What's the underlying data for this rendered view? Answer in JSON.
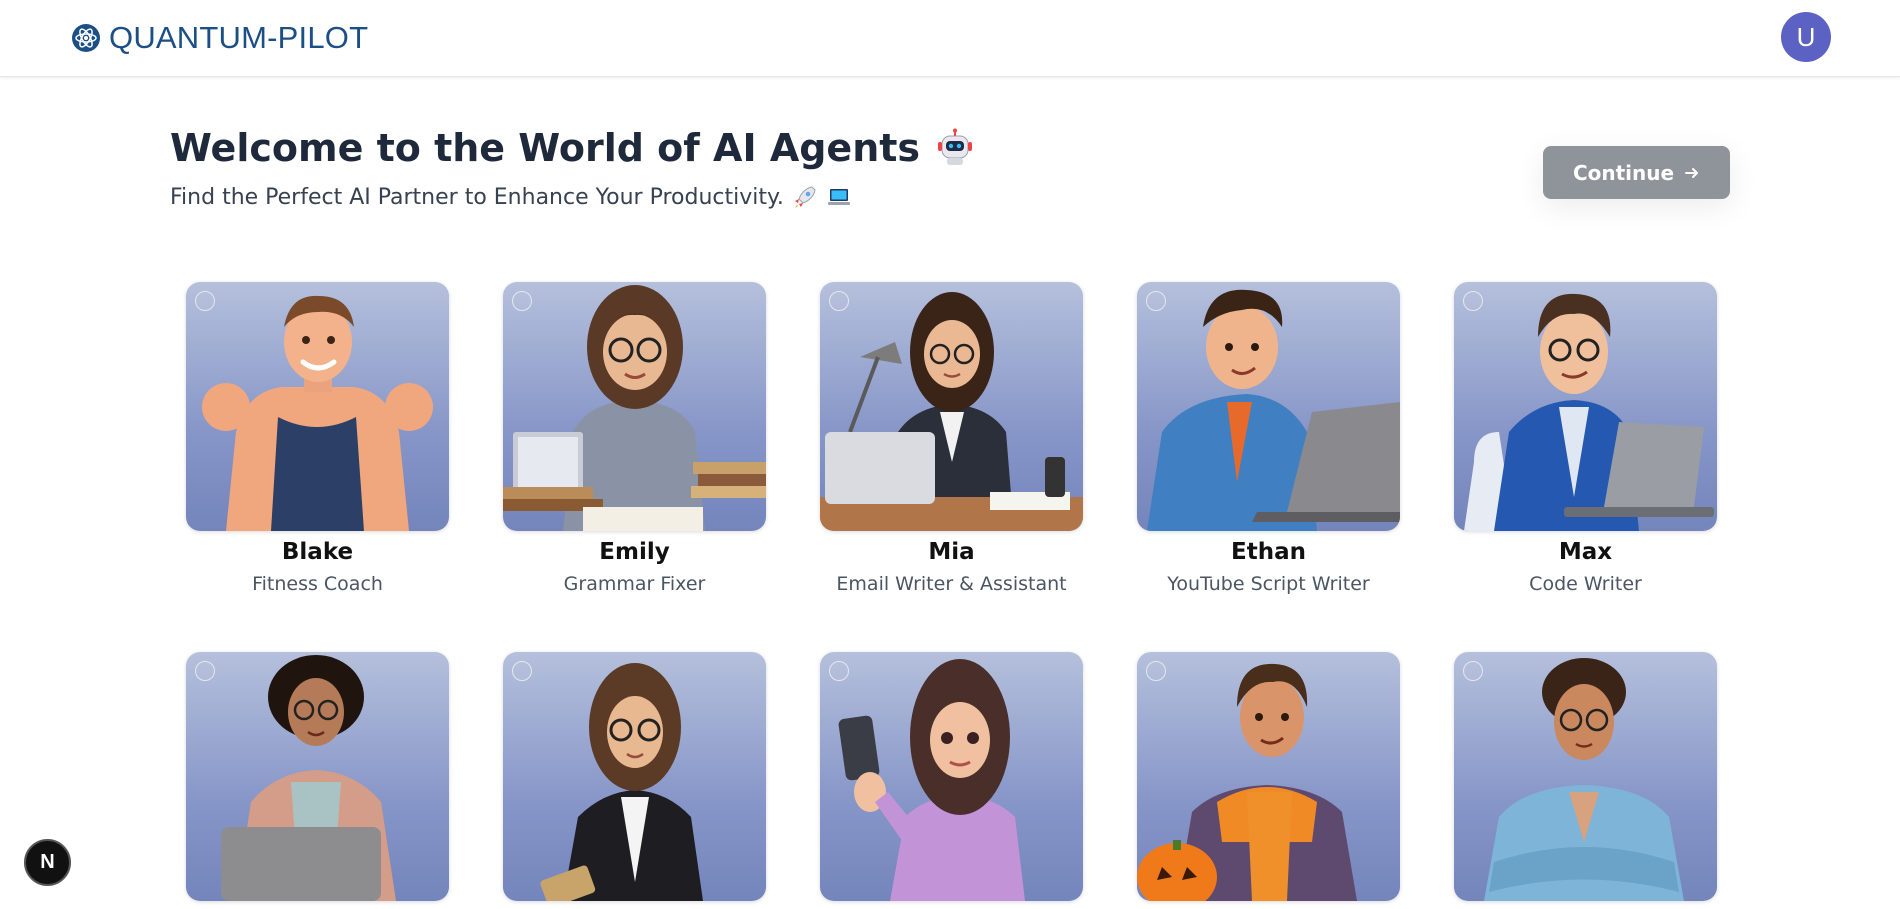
{
  "header": {
    "brand": "QUANTUM-PILOT",
    "brand_icon": "atom-icon",
    "avatar_initial": "U"
  },
  "hero": {
    "title": "Welcome to the World of AI Agents",
    "title_emoji": "robot-icon",
    "subtitle": "Find the Perfect AI Partner to Enhance Your Productivity.",
    "subtitle_emojis": [
      "rocket-icon",
      "laptop-icon"
    ]
  },
  "actions": {
    "continue_label": "Continue",
    "continue_icon": "arrow-right-icon"
  },
  "agents": [
    {
      "name": "Blake",
      "role": "Fitness Coach",
      "selected": false
    },
    {
      "name": "Emily",
      "role": "Grammar Fixer",
      "selected": false
    },
    {
      "name": "Mia",
      "role": "Email Writer & Assistant",
      "selected": false
    },
    {
      "name": "Ethan",
      "role": "YouTube Script Writer",
      "selected": false
    },
    {
      "name": "Max",
      "role": "Code Writer",
      "selected": false
    },
    {
      "name": "",
      "role": "",
      "selected": false
    },
    {
      "name": "",
      "role": "",
      "selected": false
    },
    {
      "name": "",
      "role": "",
      "selected": false
    },
    {
      "name": "",
      "role": "",
      "selected": false
    },
    {
      "name": "",
      "role": "",
      "selected": false
    }
  ],
  "devtools": {
    "badge": "N"
  },
  "colors": {
    "brand": "#1b4f86",
    "avatar": "#5b62c4",
    "continue_bg": "#8f949b",
    "card_gradient_top": "#b5c0dc",
    "card_gradient_bottom": "#7485bc"
  }
}
